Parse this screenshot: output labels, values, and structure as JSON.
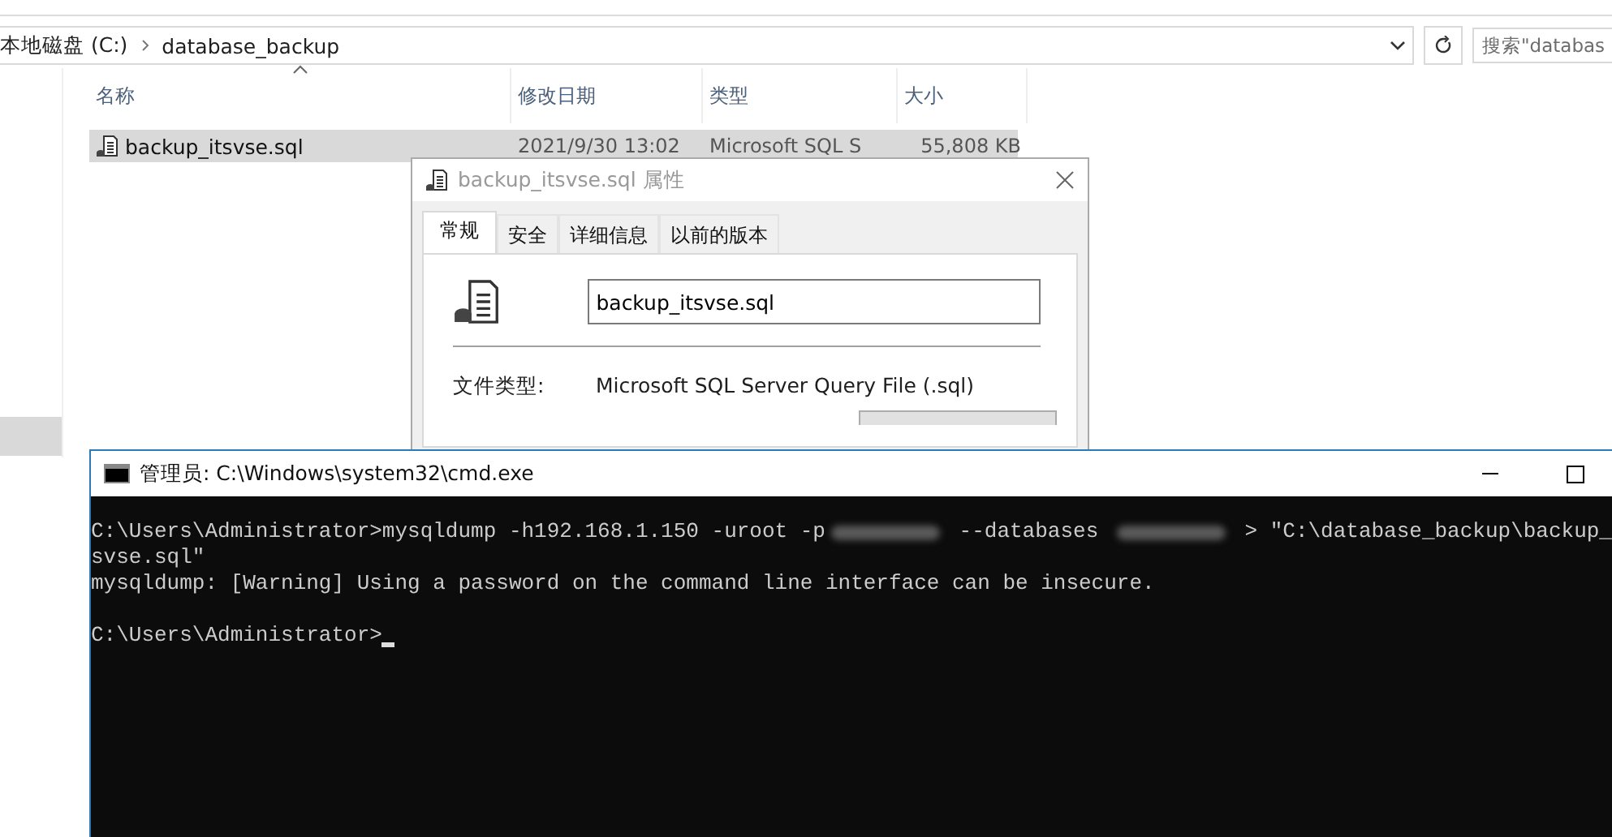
{
  "explorer": {
    "breadcrumb": [
      "本地磁盘 (C:)",
      "database_backup"
    ],
    "search": {
      "placeholder": "搜索\"databas"
    },
    "columns": [
      {
        "label": "名称",
        "sorted": true
      },
      {
        "label": "修改日期",
        "sorted": false
      },
      {
        "label": "类型",
        "sorted": false
      },
      {
        "label": "大小",
        "sorted": false
      }
    ],
    "rows": [
      {
        "name": "backup_itsvse.sql",
        "modified": "2021/9/30 13:02",
        "type": "Microsoft SQL S",
        "size": "55,808 KB",
        "selected": true
      }
    ]
  },
  "properties_dialog": {
    "title": "backup_itsvse.sql 属性",
    "tabs": [
      {
        "label": "常规",
        "selected": true
      },
      {
        "label": "安全",
        "selected": false
      },
      {
        "label": "详细信息",
        "selected": false
      },
      {
        "label": "以前的版本",
        "selected": false
      }
    ],
    "file_name": "backup_itsvse.sql",
    "fields": [
      {
        "label": "文件类型:",
        "value": "Microsoft SQL Server Query File (.sql)"
      }
    ]
  },
  "console": {
    "title": "管理员: C:\\Windows\\system32\\cmd.exe",
    "lines": [
      [
        {
          "kind": "text",
          "text": "C:\\Users\\Administrator>mysqldump -h192.168.1.150 -uroot -p"
        },
        {
          "kind": "redacted"
        },
        {
          "kind": "text",
          "text": " --databases "
        },
        {
          "kind": "redacted"
        },
        {
          "kind": "text",
          "text": " > \"C:\\database_backup\\backup_"
        }
      ],
      [
        {
          "kind": "text",
          "text": "svse.sql\""
        }
      ],
      [
        {
          "kind": "text",
          "text": "mysqldump: [Warning] Using a password on the command line interface can be insecure."
        }
      ],
      [
        {
          "kind": "blank"
        }
      ],
      [
        {
          "kind": "text",
          "text": "C:\\Users\\Administrator>"
        },
        {
          "kind": "cursor"
        }
      ]
    ]
  }
}
